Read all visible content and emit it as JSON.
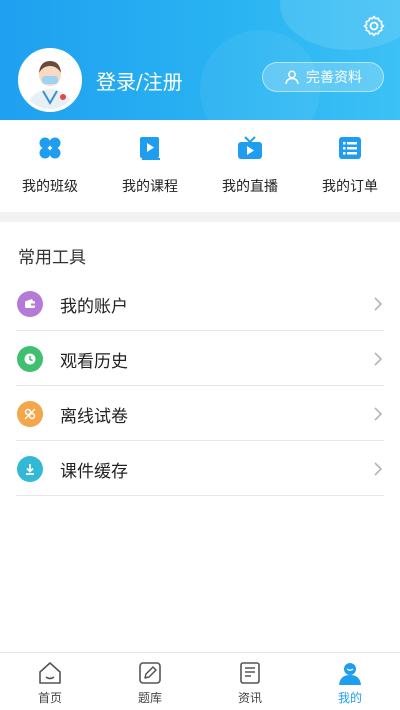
{
  "header": {
    "login_label": "登录/注册",
    "profile_button_label": "完善资料"
  },
  "quick_actions": [
    {
      "label": "我的班级",
      "icon": "clover-icon"
    },
    {
      "label": "我的课程",
      "icon": "book-play-icon"
    },
    {
      "label": "我的直播",
      "icon": "tv-icon"
    },
    {
      "label": "我的订单",
      "icon": "order-list-icon"
    }
  ],
  "tools": {
    "title": "常用工具",
    "items": [
      {
        "label": "我的账户",
        "icon": "wallet-icon",
        "color": "#b57ad6"
      },
      {
        "label": "观看历史",
        "icon": "clock-icon",
        "color": "#3fbf6f"
      },
      {
        "label": "离线试卷",
        "icon": "offline-icon",
        "color": "#f3a64a"
      },
      {
        "label": "课件缓存",
        "icon": "download-icon",
        "color": "#33b9d6"
      }
    ]
  },
  "bottom_nav": [
    {
      "label": "首页",
      "icon": "home-icon"
    },
    {
      "label": "题库",
      "icon": "pencil-icon"
    },
    {
      "label": "资讯",
      "icon": "news-icon"
    },
    {
      "label": "我的",
      "icon": "user-icon",
      "active": true
    }
  ],
  "colors": {
    "accent": "#1f9ef0",
    "header_gradient_start": "#1fa0f0",
    "header_gradient_end": "#3cc1f5"
  }
}
